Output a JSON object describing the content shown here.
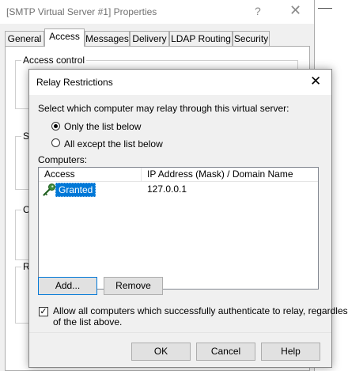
{
  "parent_window": {
    "title": "[SMTP Virtual Server #1] Properties",
    "help_glyph": "?",
    "close_glyph": "✕",
    "tabs": [
      {
        "label": "General",
        "active": false
      },
      {
        "label": "Access",
        "active": true
      },
      {
        "label": "Messages",
        "active": false
      },
      {
        "label": "Delivery",
        "active": false
      },
      {
        "label": "LDAP Routing",
        "active": false
      },
      {
        "label": "Security",
        "active": false
      }
    ],
    "groups": {
      "access_control": "Access control",
      "g2_fragment": "S",
      "g3_fragment": "C",
      "g4_fragment": "R"
    }
  },
  "dialog": {
    "title": "Relay Restrictions",
    "close_glyph": "✕",
    "prompt": "Select which computer may relay through this virtual server:",
    "radio_only": "Only the list below",
    "radio_all_except": "All except the list below",
    "selected_radio": "only",
    "computers_label": "Computers:",
    "list": {
      "columns": [
        "Access",
        "IP Address (Mask) / Domain Name"
      ],
      "rows": [
        {
          "access": "Granted",
          "ip": "127.0.0.1",
          "selected": true,
          "icon": "key-icon"
        }
      ]
    },
    "add_button": "Add...",
    "remove_button": "Remove",
    "allow_auth_checked": true,
    "allow_auth_line1": "Allow all computers which successfully authenticate to relay, regardless",
    "allow_auth_line2": "of the list above.",
    "ok_button": "OK",
    "cancel_button": "Cancel",
    "help_button": "Help"
  },
  "colors": {
    "selection": "#0078d7",
    "window_bg": "#f0f0f0",
    "button_bg": "#e1e1e1"
  }
}
